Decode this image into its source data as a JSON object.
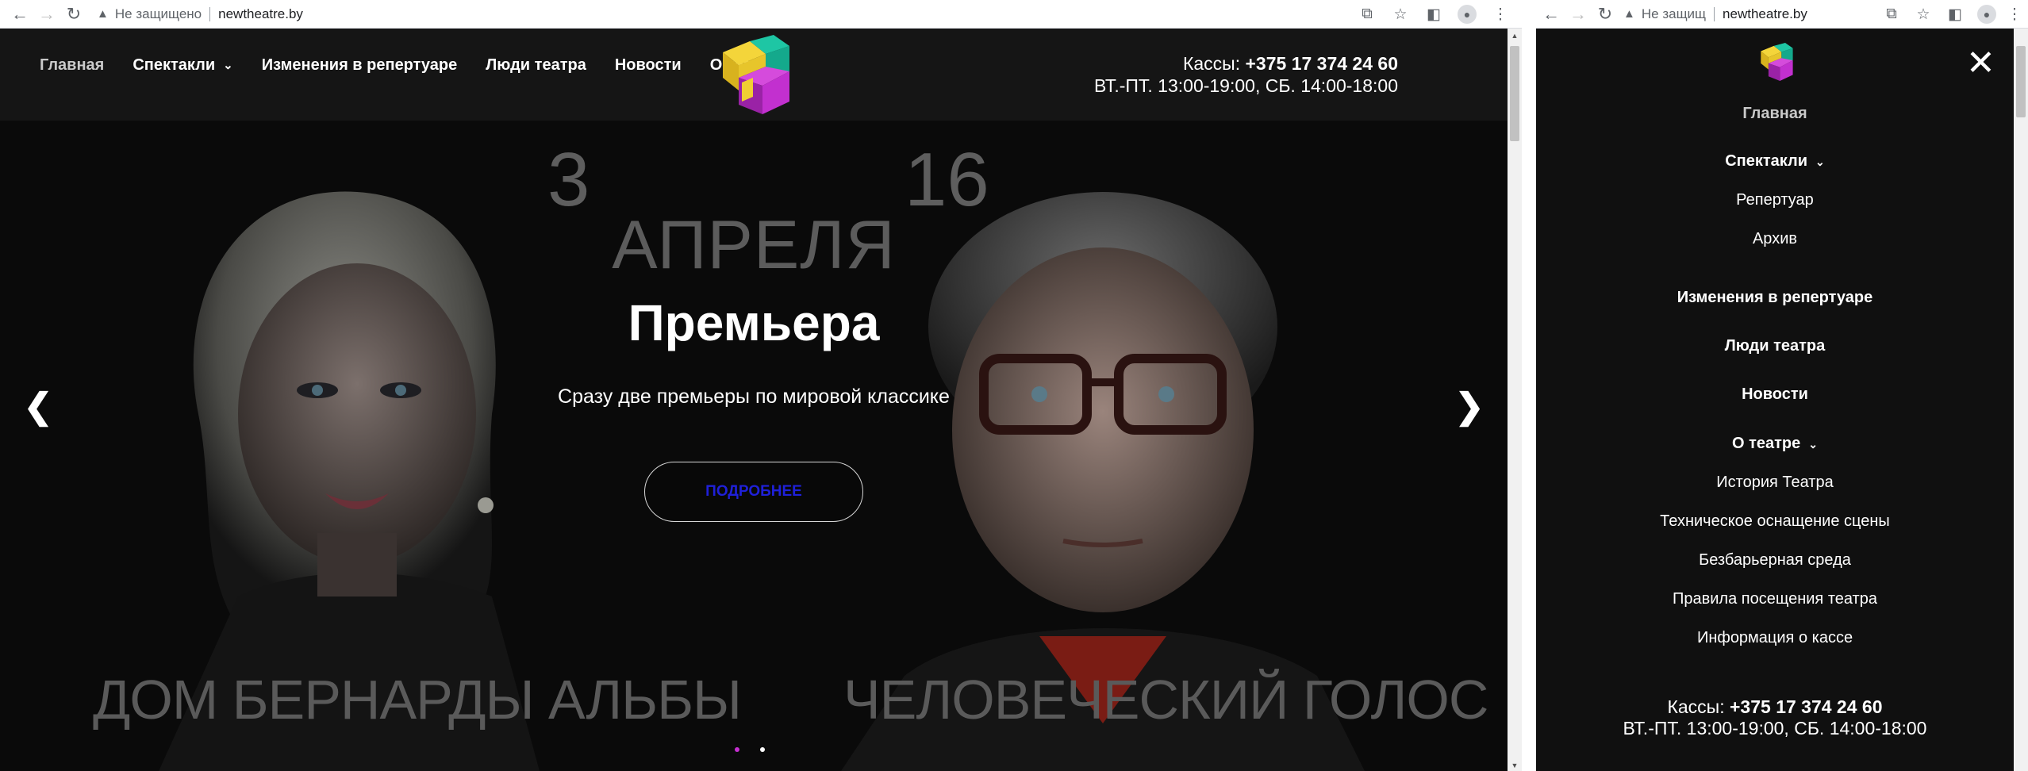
{
  "browser": {
    "security_label": "Не защищено",
    "security_label_short": "Не защищ",
    "url": "newtheatre.by"
  },
  "site": {
    "nav": [
      {
        "label": "Главная"
      },
      {
        "label": "Спектакли"
      },
      {
        "label": "Изменения в репертуаре"
      },
      {
        "label": "Люди театра"
      },
      {
        "label": "Новости"
      },
      {
        "label": "О театре"
      }
    ],
    "nav_truncated_label": "О теа",
    "contacts": {
      "prefix": "Кассы: ",
      "phone": "+375 17  374 24 60",
      "hours": "ВТ.-ПТ. 13:00-19:00,  СБ. 14:00-18:00"
    },
    "colors": {
      "accent_magenta": "#c62fd1",
      "accent_yellow": "#f2d22e",
      "accent_teal": "#19c9a8",
      "button_text": "#1f20d9"
    }
  },
  "hero": {
    "day_left": "3",
    "day_right": "16",
    "month": "АПРЕЛЯ",
    "heading": "Премьера",
    "subtitle": "Сразу две премьеры по мировой классике",
    "button": "ПОДРОБНЕЕ",
    "title_left": "ДОМ БЕРНАРДЫ АЛЬБЫ",
    "title_right": "ЧЕЛОВЕЧЕСКИЙ ГОЛОС",
    "slides_total": 2,
    "slide_active": 1
  },
  "mobile_menu": {
    "home": "Главная",
    "performances": "Спектакли",
    "performances_sub": [
      "Репертуар",
      "Архив"
    ],
    "changes": "Изменения в репертуаре",
    "people": "Люди театра",
    "news": "Новости",
    "about": "О театре",
    "about_sub": [
      "История Театра",
      "Техническое оснащение сцены",
      "Безбарьерная среда",
      "Правила посещения театра",
      "Информация о кассе"
    ]
  }
}
